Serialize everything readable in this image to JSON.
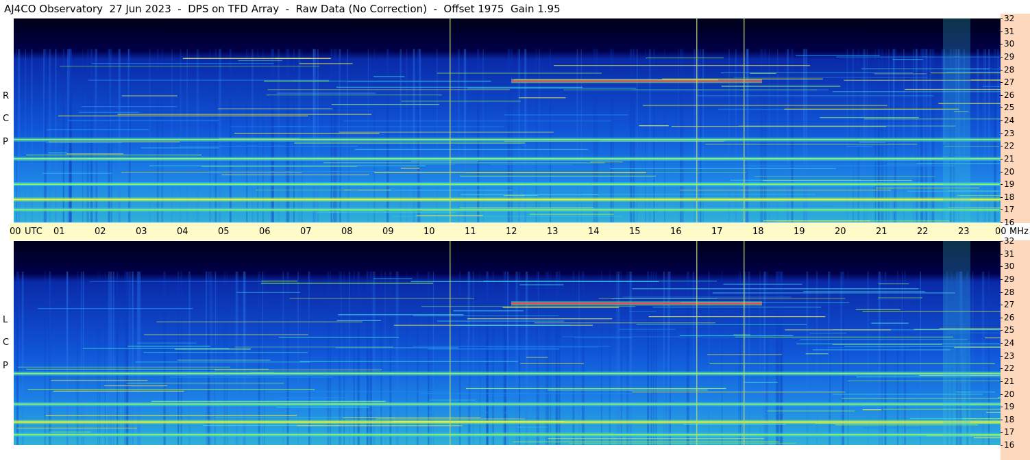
{
  "title": "AJ4CO Observatory  27 Jun 2023  -  DPS on TFD Array  -  Raw Data (No Correction)  -  Offset 1975  Gain 1.95",
  "panels": [
    {
      "label": [
        "R",
        "C",
        "P"
      ]
    },
    {
      "label": [
        "L",
        "C",
        "P"
      ]
    }
  ],
  "time_axis": {
    "labels": [
      "00",
      "UTC",
      "01",
      "02",
      "03",
      "04",
      "05",
      "06",
      "07",
      "08",
      "09",
      "10",
      "11",
      "12",
      "13",
      "14",
      "15",
      "16",
      "17",
      "18",
      "19",
      "20",
      "21",
      "22",
      "23",
      "00"
    ],
    "unit": "MHz"
  },
  "freq_axis": {
    "labels": [
      "32",
      "31",
      "30",
      "29",
      "28",
      "27",
      "26",
      "25",
      "24",
      "23",
      "22",
      "21",
      "20",
      "19",
      "18",
      "17",
      "16"
    ]
  },
  "chart_data": [
    {
      "type": "heatmap",
      "title": "",
      "series_label": "RCP",
      "xlabel": "UTC",
      "ylabel": "MHz",
      "x_range": [
        "00",
        "00"
      ],
      "ylim": [
        16,
        32
      ],
      "x_ticks": [
        "00",
        "01",
        "02",
        "03",
        "04",
        "05",
        "06",
        "07",
        "08",
        "09",
        "10",
        "11",
        "12",
        "13",
        "14",
        "15",
        "16",
        "17",
        "18",
        "19",
        "20",
        "21",
        "22",
        "23",
        "00"
      ],
      "y_ticks": [
        16,
        17,
        18,
        19,
        20,
        21,
        22,
        23,
        24,
        25,
        26,
        27,
        28,
        29,
        30,
        31,
        32
      ],
      "colormap": [
        "#00008a",
        "#0050e0",
        "#1f8ef0",
        "#3ccde0",
        "#8cf060",
        "#f0f040",
        "#ff6a2a",
        "#ff2e9a"
      ],
      "features": [
        {
          "kind": "band",
          "freq_mhz": 27.1,
          "t_start": 12.1,
          "t_end": 18.2,
          "intensity": 0.9
        },
        {
          "kind": "band",
          "freq_mhz": 17.8,
          "t_start": 0.0,
          "t_end": 24.0,
          "intensity": 0.8
        },
        {
          "kind": "band",
          "freq_mhz": 17.0,
          "t_start": 0.0,
          "t_end": 24.0,
          "intensity": 0.6
        },
        {
          "kind": "band",
          "freq_mhz": 21.0,
          "t_start": 0.0,
          "t_end": 24.0,
          "intensity": 0.5
        },
        {
          "kind": "band",
          "freq_mhz": 22.5,
          "t_start": 0.0,
          "t_end": 24.0,
          "intensity": 0.45
        },
        {
          "kind": "band",
          "freq_mhz": 19.0,
          "t_start": 0.0,
          "t_end": 24.0,
          "intensity": 0.5
        },
        {
          "kind": "vline",
          "time_utc": 10.6
        },
        {
          "kind": "vline",
          "time_utc": 16.6
        },
        {
          "kind": "vline",
          "time_utc": 17.75
        }
      ]
    },
    {
      "type": "heatmap",
      "title": "",
      "series_label": "LCP",
      "xlabel": "UTC",
      "ylabel": "MHz",
      "x_range": [
        "00",
        "00"
      ],
      "ylim": [
        16,
        32
      ],
      "x_ticks": [
        "00",
        "01",
        "02",
        "03",
        "04",
        "05",
        "06",
        "07",
        "08",
        "09",
        "10",
        "11",
        "12",
        "13",
        "14",
        "15",
        "16",
        "17",
        "18",
        "19",
        "20",
        "21",
        "22",
        "23",
        "00"
      ],
      "y_ticks": [
        16,
        17,
        18,
        19,
        20,
        21,
        22,
        23,
        24,
        25,
        26,
        27,
        28,
        29,
        30,
        31,
        32
      ],
      "colormap": [
        "#00008a",
        "#0050e0",
        "#1f8ef0",
        "#3ccde0",
        "#8cf060",
        "#f0f040",
        "#ff6a2a",
        "#ff2e9a"
      ],
      "features": [
        {
          "kind": "band",
          "freq_mhz": 27.1,
          "t_start": 12.1,
          "t_end": 18.2,
          "intensity": 0.9
        },
        {
          "kind": "band",
          "freq_mhz": 17.8,
          "t_start": 0.0,
          "t_end": 24.0,
          "intensity": 0.8
        },
        {
          "kind": "band",
          "freq_mhz": 16.8,
          "t_start": 0.0,
          "t_end": 24.0,
          "intensity": 0.6
        },
        {
          "kind": "band",
          "freq_mhz": 21.6,
          "t_start": 0.0,
          "t_end": 24.0,
          "intensity": 0.45
        },
        {
          "kind": "band",
          "freq_mhz": 19.2,
          "t_start": 0.0,
          "t_end": 24.0,
          "intensity": 0.5
        },
        {
          "kind": "vline",
          "time_utc": 10.6
        },
        {
          "kind": "vline",
          "time_utc": 16.6
        },
        {
          "kind": "vline",
          "time_utc": 17.75
        }
      ]
    }
  ]
}
